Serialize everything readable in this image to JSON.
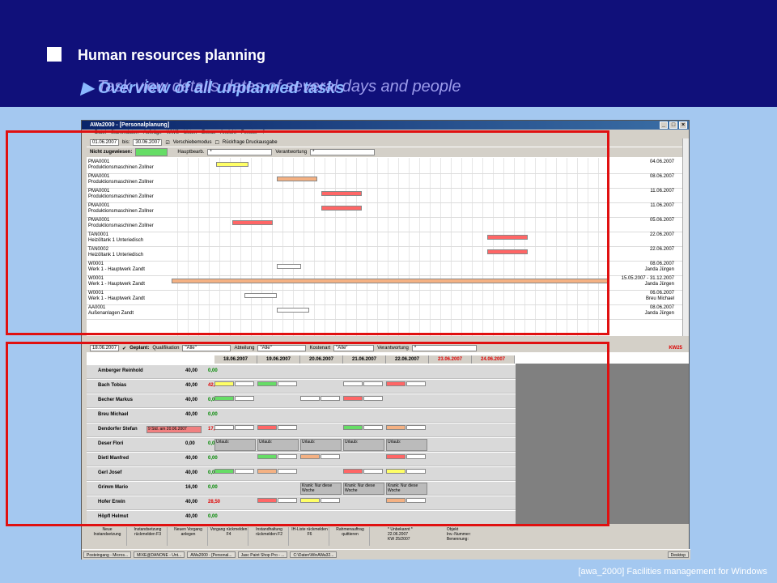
{
  "slide": {
    "title": "Human resources planning",
    "subtitle": "Overview of all unplanned tasks",
    "subtitle_overlay": "Task view details dates of several days and people",
    "footer": "[awa_2000]  Facilities management for Windows"
  },
  "window": {
    "title": "AWa2000 - [Personalplanung]"
  },
  "menu": [
    "Datei",
    "Stammdaten",
    "Aufträge",
    "WWS",
    "Listen",
    "Extras",
    "Ansicht",
    "Fenster",
    "?"
  ],
  "upper_toolbar": {
    "from_date": "01.06.2007",
    "to_label": "bis:",
    "to_date": "30.06.2007",
    "move_mode": "Verschiebemodus",
    "print_prompt": "Rückfrage Druckausgabe",
    "not_assigned": "Nicht zugewiesen:",
    "main_editor": "Hauptbearb.",
    "main_editor_value": "*",
    "responsible": "Verantwortung",
    "responsible_value": "*"
  },
  "tasks": [
    {
      "code": "PMA0001",
      "desc": "Produktionsmaschinen Zollner",
      "date": "04.06.2007"
    },
    {
      "code": "PMA0001",
      "desc": "Produktionsmaschinen Zollner",
      "date": "08.06.2007"
    },
    {
      "code": "PMA0001",
      "desc": "Produktionsmaschinen Zollner",
      "date": "11.06.2007"
    },
    {
      "code": "PMA0001",
      "desc": "Produktionsmaschinen Zollner",
      "date": "11.06.2007"
    },
    {
      "code": "PMA0001",
      "desc": "Produktionsmaschinen Zollner",
      "date": "05.06.2007"
    },
    {
      "code": "TAN0001",
      "desc": "Heizöltank 1 Unteriedisch",
      "date": "22.06.2007"
    },
    {
      "code": "TAN0002",
      "desc": "Heizöltank 1 Unteriedisch",
      "date": "22.06.2007"
    },
    {
      "code": "W0001",
      "desc": "Werk 1 - Hauptwerk Zandt",
      "date": "08.06.2007",
      "person": "Janda Jürgen"
    },
    {
      "code": "W0001",
      "desc": "Werk 1 - Hauptwerk Zandt",
      "date": "15.05.2007 - 31.12.2007",
      "person": "Janda Jürgen"
    },
    {
      "code": "W0001",
      "desc": "Werk 1 - Hauptwerk Zandt",
      "date": "06.06.2007",
      "person": "Breu Michael"
    },
    {
      "code": "AA0001",
      "desc": "Außenanlagen Zandt",
      "date": "08.06.2007",
      "person": "Janda Jürgen"
    }
  ],
  "lower_toolbar": {
    "date": "18.06.2007",
    "planned": "Geplant:",
    "qualification": "Qualifikation",
    "qual_value": "\"Alle\"",
    "department": "Abteilung",
    "dept_value": "\"Alle\"",
    "cost_type": "Kostenart",
    "cost_value": "\"Alle\"",
    "responsible": "Verantwortung",
    "resp_value": "*",
    "week": "KW25"
  },
  "days": [
    "18.06.2007",
    "19.06.2007",
    "20.06.2007",
    "21.06.2007",
    "22.06.2007",
    "23.06.2007",
    "24.06.2007"
  ],
  "people": [
    {
      "name": "Amberger Reinhold",
      "hours": "40,00",
      "over": "0,00"
    },
    {
      "name": "Bach Tobias",
      "hours": "40,00",
      "over": "42,50"
    },
    {
      "name": "Becher Markus",
      "hours": "40,00",
      "over": "0,00"
    },
    {
      "name": "Breu Michael",
      "hours": "40,00",
      "over": "0,00"
    },
    {
      "name": "Dendorfer Stefan",
      "hours": "40,00",
      "over": "17,00",
      "note": "9 Std. am 20.06.2007"
    },
    {
      "name": "Deser Flori",
      "hours": "0,00",
      "over": "0,00"
    },
    {
      "name": "Dietl Manfred",
      "hours": "40,00",
      "over": "0,00"
    },
    {
      "name": "Gerl Josef",
      "hours": "40,00",
      "over": "0,00"
    },
    {
      "name": "Grimm Mario",
      "hours": "16,00",
      "over": "0,00"
    },
    {
      "name": "Hofer Erwin",
      "hours": "40,00",
      "over": "28,50"
    },
    {
      "name": "Höpfl Helmut",
      "hours": "40,00",
      "over": "0,00"
    }
  ],
  "vacation": "Urlaub:",
  "sick": "Krank: Nur diese Woche",
  "bottom_buttons": [
    "Neue Instandsetzung",
    "Instandsetzung rückmelden F3",
    "Neuen Vorgang anlegen",
    "Vorgang rückmelden F4",
    "Instandhaltung rückmelden F2",
    "IH-Liste rückmelden F6",
    "Rahmenauftrag quittieren"
  ],
  "info": {
    "unknown": "* Unbekannt *",
    "date": "22.06.2007",
    "kw": "KW 25/2007",
    "object": "Objekt",
    "inv": "Inv.-Nummer:",
    "name": "Benennung:"
  },
  "taskbar": [
    "Posteingang - Micros...",
    "MIXE@DANONE - Unt...",
    "AWa2000 - [Personal...",
    "Jasc Paint Shop Pro - ...",
    "C:\\Daten\\WinAWa32...",
    "Desktop"
  ],
  "colors": {
    "banner": "#10107a",
    "highlight": "#e01010",
    "orange": "#f4b183",
    "yellow": "#ffff66",
    "red": "#ff6666",
    "green": "#66dd66"
  }
}
